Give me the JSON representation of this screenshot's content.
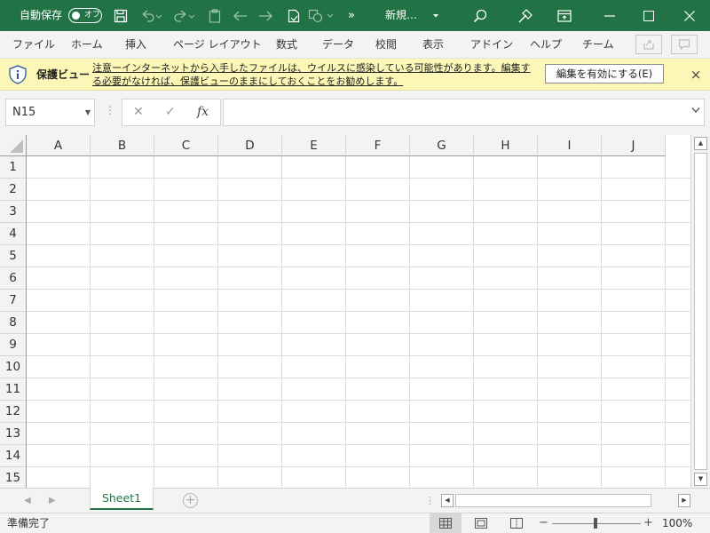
{
  "titlebar": {
    "autosave_label": "自動保存",
    "autosave_state": "オフ",
    "doc_title": "新規…",
    "more_chevron": "»",
    "icons": [
      "save-icon",
      "undo-icon",
      "redo-icon",
      "clipboard-icon",
      "back-arrow-icon",
      "forward-arrow-icon",
      "document-icon",
      "shape-icon",
      "search-icon",
      "wand-icon",
      "ribbon-display-icon",
      "minimize-icon",
      "maximize-icon",
      "close-icon"
    ]
  },
  "ribbon": {
    "tabs": [
      "ファイル",
      "ホーム",
      "挿入",
      "ページ レイアウト",
      "数式",
      "データ",
      "校閲",
      "表示",
      "アドイン",
      "ヘルプ",
      "チーム"
    ]
  },
  "protected_view": {
    "title": "保護ビュー",
    "message": "注意ーインターネットから入手したファイルは、ウイルスに感染している可能性があります。編集する必要がなければ、保護ビューのままにしておくことをお勧めします。",
    "enable_button": "編集を有効にする(E)",
    "close": "×"
  },
  "formula_bar": {
    "name_box": "N15",
    "cancel": "✕",
    "enter": "✓",
    "fx": "fx",
    "formula": ""
  },
  "grid": {
    "columns": [
      "A",
      "B",
      "C",
      "D",
      "E",
      "F",
      "G",
      "H",
      "I",
      "J"
    ],
    "rows": [
      "1",
      "2",
      "3",
      "4",
      "5",
      "6",
      "7",
      "8",
      "9",
      "10",
      "11",
      "12",
      "13",
      "14",
      "15"
    ]
  },
  "sheets": {
    "tabs": [
      "Sheet1"
    ],
    "add": "+"
  },
  "status": {
    "text": "準備完了",
    "zoom_minus": "−",
    "zoom_plus": "+",
    "zoom": "100%"
  },
  "colors": {
    "accent": "#217346",
    "protected_bar": "#fcf7b6"
  }
}
